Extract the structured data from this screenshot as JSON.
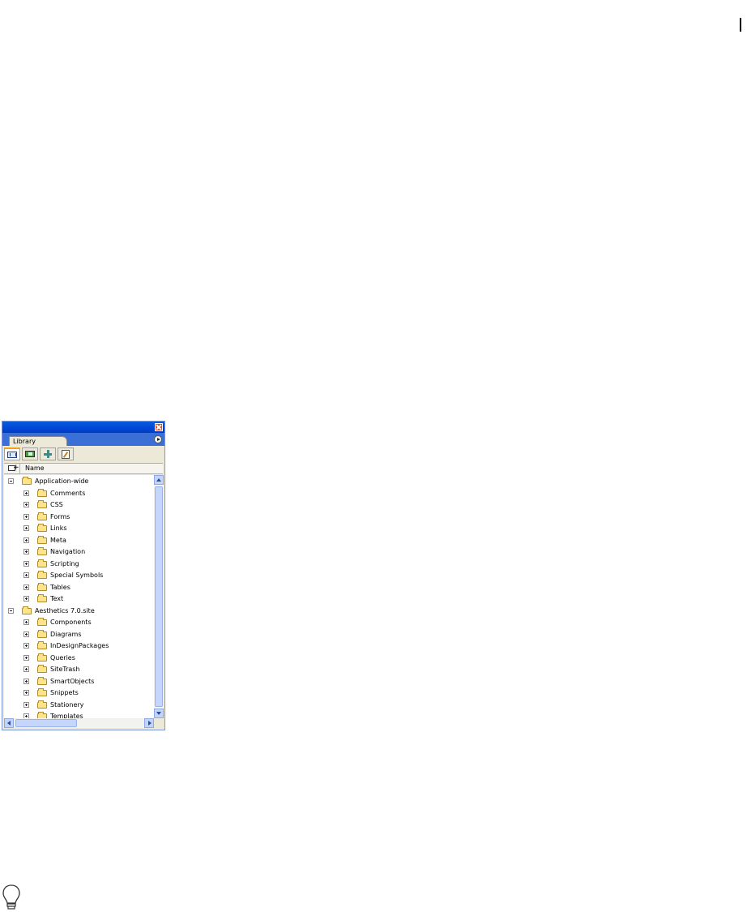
{
  "panel": {
    "tab_label": "Library",
    "column_header": "Name",
    "tree": [
      {
        "label": "Application-wide",
        "level": 0,
        "expanded": true
      },
      {
        "label": "Comments",
        "level": 1,
        "expanded": false
      },
      {
        "label": "CSS",
        "level": 1,
        "expanded": false
      },
      {
        "label": "Forms",
        "level": 1,
        "expanded": false
      },
      {
        "label": "Links",
        "level": 1,
        "expanded": false
      },
      {
        "label": "Meta",
        "level": 1,
        "expanded": false
      },
      {
        "label": "Navigation",
        "level": 1,
        "expanded": false
      },
      {
        "label": "Scripting",
        "level": 1,
        "expanded": false
      },
      {
        "label": "Special Symbols",
        "level": 1,
        "expanded": false
      },
      {
        "label": "Tables",
        "level": 1,
        "expanded": false
      },
      {
        "label": "Text",
        "level": 1,
        "expanded": false
      },
      {
        "label": "Aesthetics 7.0.site",
        "level": 0,
        "expanded": true
      },
      {
        "label": "Components",
        "level": 1,
        "expanded": false
      },
      {
        "label": "Diagrams",
        "level": 1,
        "expanded": false
      },
      {
        "label": "InDesignPackages",
        "level": 1,
        "expanded": false
      },
      {
        "label": "Queries",
        "level": 1,
        "expanded": false
      },
      {
        "label": "SiteTrash",
        "level": 1,
        "expanded": false
      },
      {
        "label": "SmartObjects",
        "level": 1,
        "expanded": false
      },
      {
        "label": "Snippets",
        "level": 1,
        "expanded": false
      },
      {
        "label": "Stationery",
        "level": 1,
        "expanded": false
      },
      {
        "label": "Templates",
        "level": 1,
        "expanded": false
      }
    ],
    "toolbar_tabs": [
      "code-snippets-icon",
      "images-icon",
      "components-icon",
      "text-clips-icon"
    ],
    "active_tab_index": 0
  },
  "colors": {
    "titlebar": "#0046d5",
    "folder": "#fde48a",
    "close": "#e04a1c"
  },
  "icons": {
    "tip": "lightbulb-icon"
  }
}
